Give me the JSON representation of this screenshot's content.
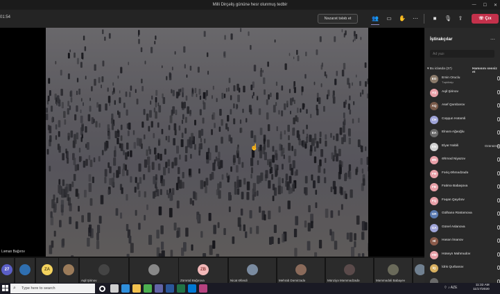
{
  "window": {
    "title": "Milli Dirçəliş gününə hesr olunmuş tedbir"
  },
  "toolbar": {
    "timer": "01:54",
    "request_control_label": "Nəzarət tələb et",
    "leave_label": "Çıx",
    "icons": [
      "participants-icon",
      "chat-icon",
      "raise-hand-icon",
      "more-icon",
      "camera-icon",
      "mic-icon",
      "share-icon"
    ]
  },
  "stage": {
    "presenter_label": "Ləman Bağırov"
  },
  "thumbnails": [
    {
      "initials": "27",
      "name": "",
      "color": "#5b5fc7"
    },
    {
      "initials": "",
      "name": "",
      "color": "#2f6fb0"
    },
    {
      "initials": "ZA",
      "name": "",
      "color": "#f4d35e"
    },
    {
      "initials": "",
      "name": "",
      "color": "#9b7b5a"
    },
    {
      "initials": "",
      "name": "Aqil Şirinov",
      "color": "#444"
    },
    {
      "initials": "",
      "name": "",
      "color": "#888"
    },
    {
      "initials": "ZB",
      "name": "Zümrüd Bağırova",
      "color": "#f2b8b8"
    },
    {
      "initials": "",
      "name": "Nicat Əfəndi",
      "color": "#7a8ba0"
    },
    {
      "initials": "",
      "name": "Mehrab Dəmirzadə",
      "color": "#8a6a5a"
    },
    {
      "initials": "",
      "name": "Münziyə Məmmədzadə",
      "color": "#5a4a4a"
    },
    {
      "initials": "",
      "name": "Məmmədəli Babayev",
      "color": "#6a6a5a"
    },
    {
      "initials": "",
      "name": "",
      "color": "#708090"
    }
  ],
  "panel": {
    "title": "İştirakçılar",
    "search_placeholder": "Ad yazı",
    "section_label": "Bu iclasda (37)",
    "mute_all_label": "Hamısını səssiz et",
    "participants": [
      {
        "name": "Emin Oruclu",
        "sub": "Təşkilatçı",
        "initials": "EO",
        "color": "#8a7a6a",
        "badge": ""
      },
      {
        "name": "Aqil Şirinov",
        "sub": "",
        "initials": "AŞ",
        "color": "#e8a0a8",
        "badge": ""
      },
      {
        "name": "Asef Qəmbərov",
        "sub": "",
        "initials": "AQ",
        "color": "#7a5a4a",
        "badge": ""
      },
      {
        "name": "Coşqun Hətəmli",
        "sub": "",
        "initials": "CH",
        "color": "#9fa4d8",
        "badge": ""
      },
      {
        "name": "Elnarə Ağaoğlu",
        "sub": "",
        "initials": "EA",
        "color": "#6a6a6a",
        "badge": ""
      },
      {
        "name": "Elyar Nəbili",
        "sub": "",
        "initials": "EN",
        "color": "#d0d0d0",
        "badge": "Ozünüzsü"
      },
      {
        "name": "Əhməd Niyazov",
        "sub": "",
        "initials": "ƏN",
        "color": "#e8a0a8",
        "badge": ""
      },
      {
        "name": "Fəriq Əhmədzadə",
        "sub": "",
        "initials": "FƏ",
        "color": "#e8a0a8",
        "badge": ""
      },
      {
        "name": "Fatimə Babaşova",
        "sub": "",
        "initials": "FB",
        "color": "#e8a0a8",
        "badge": ""
      },
      {
        "name": "Fəqan Qayıbov",
        "sub": "",
        "initials": "FQ",
        "color": "#e8a0a8",
        "badge": ""
      },
      {
        "name": "Gülhanə Rüstəmova",
        "sub": "",
        "initials": "GR",
        "color": "#5a7ab0",
        "badge": ""
      },
      {
        "name": "Günel Aslanova",
        "sub": "",
        "initials": "GA",
        "color": "#9fa4d8",
        "badge": ""
      },
      {
        "name": "Həsən İmanov",
        "sub": "",
        "initials": "Hİ",
        "color": "#8a5a4a",
        "badge": ""
      },
      {
        "name": "Hüseyn Mahmudov",
        "sub": "",
        "initials": "HM",
        "color": "#e8a0a8",
        "badge": ""
      },
      {
        "name": "İdris Qurbanov",
        "sub": "",
        "initials": "İQ",
        "color": "#d8b060",
        "badge": ""
      },
      {
        "name": "",
        "sub": "",
        "initials": "",
        "color": "#6a6a6a",
        "badge": ""
      }
    ]
  },
  "taskbar": {
    "search_placeholder": "Type here to search",
    "time": "11:32 AM",
    "date": "11/17/2020",
    "lang": "AZE",
    "apps": [
      {
        "icon": "cortana-icon",
        "color": "#ffffff"
      },
      {
        "icon": "task-view-icon",
        "color": "#cfcfcf"
      },
      {
        "icon": "edge-icon",
        "color": "#2f8fdc"
      },
      {
        "icon": "explorer-icon",
        "color": "#f2c14e"
      },
      {
        "icon": "chrome-icon",
        "color": "#4caf50"
      },
      {
        "icon": "teams-icon",
        "color": "#6264a7"
      },
      {
        "icon": "word-icon",
        "color": "#2b579a"
      },
      {
        "icon": "excel-icon",
        "color": "#217346"
      },
      {
        "icon": "mail-icon",
        "color": "#0078d4"
      },
      {
        "icon": "photos-icon",
        "color": "#b5427f"
      }
    ]
  }
}
